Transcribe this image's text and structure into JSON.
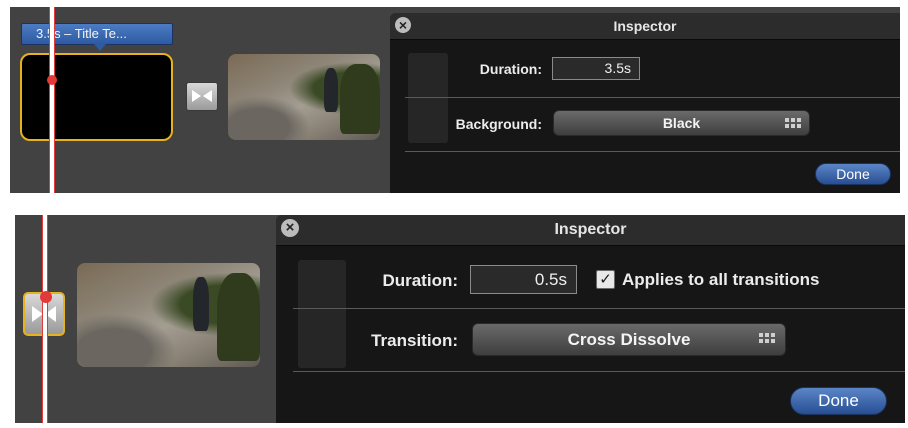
{
  "panel_top": {
    "tooltip": "3.5s – Title Te...",
    "inspector": {
      "title": "Inspector",
      "close_icon": "×",
      "duration_label": "Duration:",
      "duration_value": "3.5s",
      "background_label": "Background:",
      "background_value": "Black",
      "done_label": "Done"
    }
  },
  "panel_bottom": {
    "inspector": {
      "title": "Inspector",
      "close_icon": "×",
      "duration_label": "Duration:",
      "duration_value": "0.5s",
      "applies_checked": true,
      "applies_label": "Applies to all transitions",
      "transition_label": "Transition:",
      "transition_value": "Cross Dissolve",
      "done_label": "Done"
    }
  },
  "icons": {
    "close": "close-icon",
    "transition": "bowtie-transition-icon",
    "popup_grid": "grid-icon",
    "checkmark": "checkmark-icon"
  },
  "colors": {
    "selection_outline": "#e6b21e",
    "playhead": "#e23a3a",
    "done_button": "#3b67ae",
    "tooltip": "#3d6bb4"
  }
}
